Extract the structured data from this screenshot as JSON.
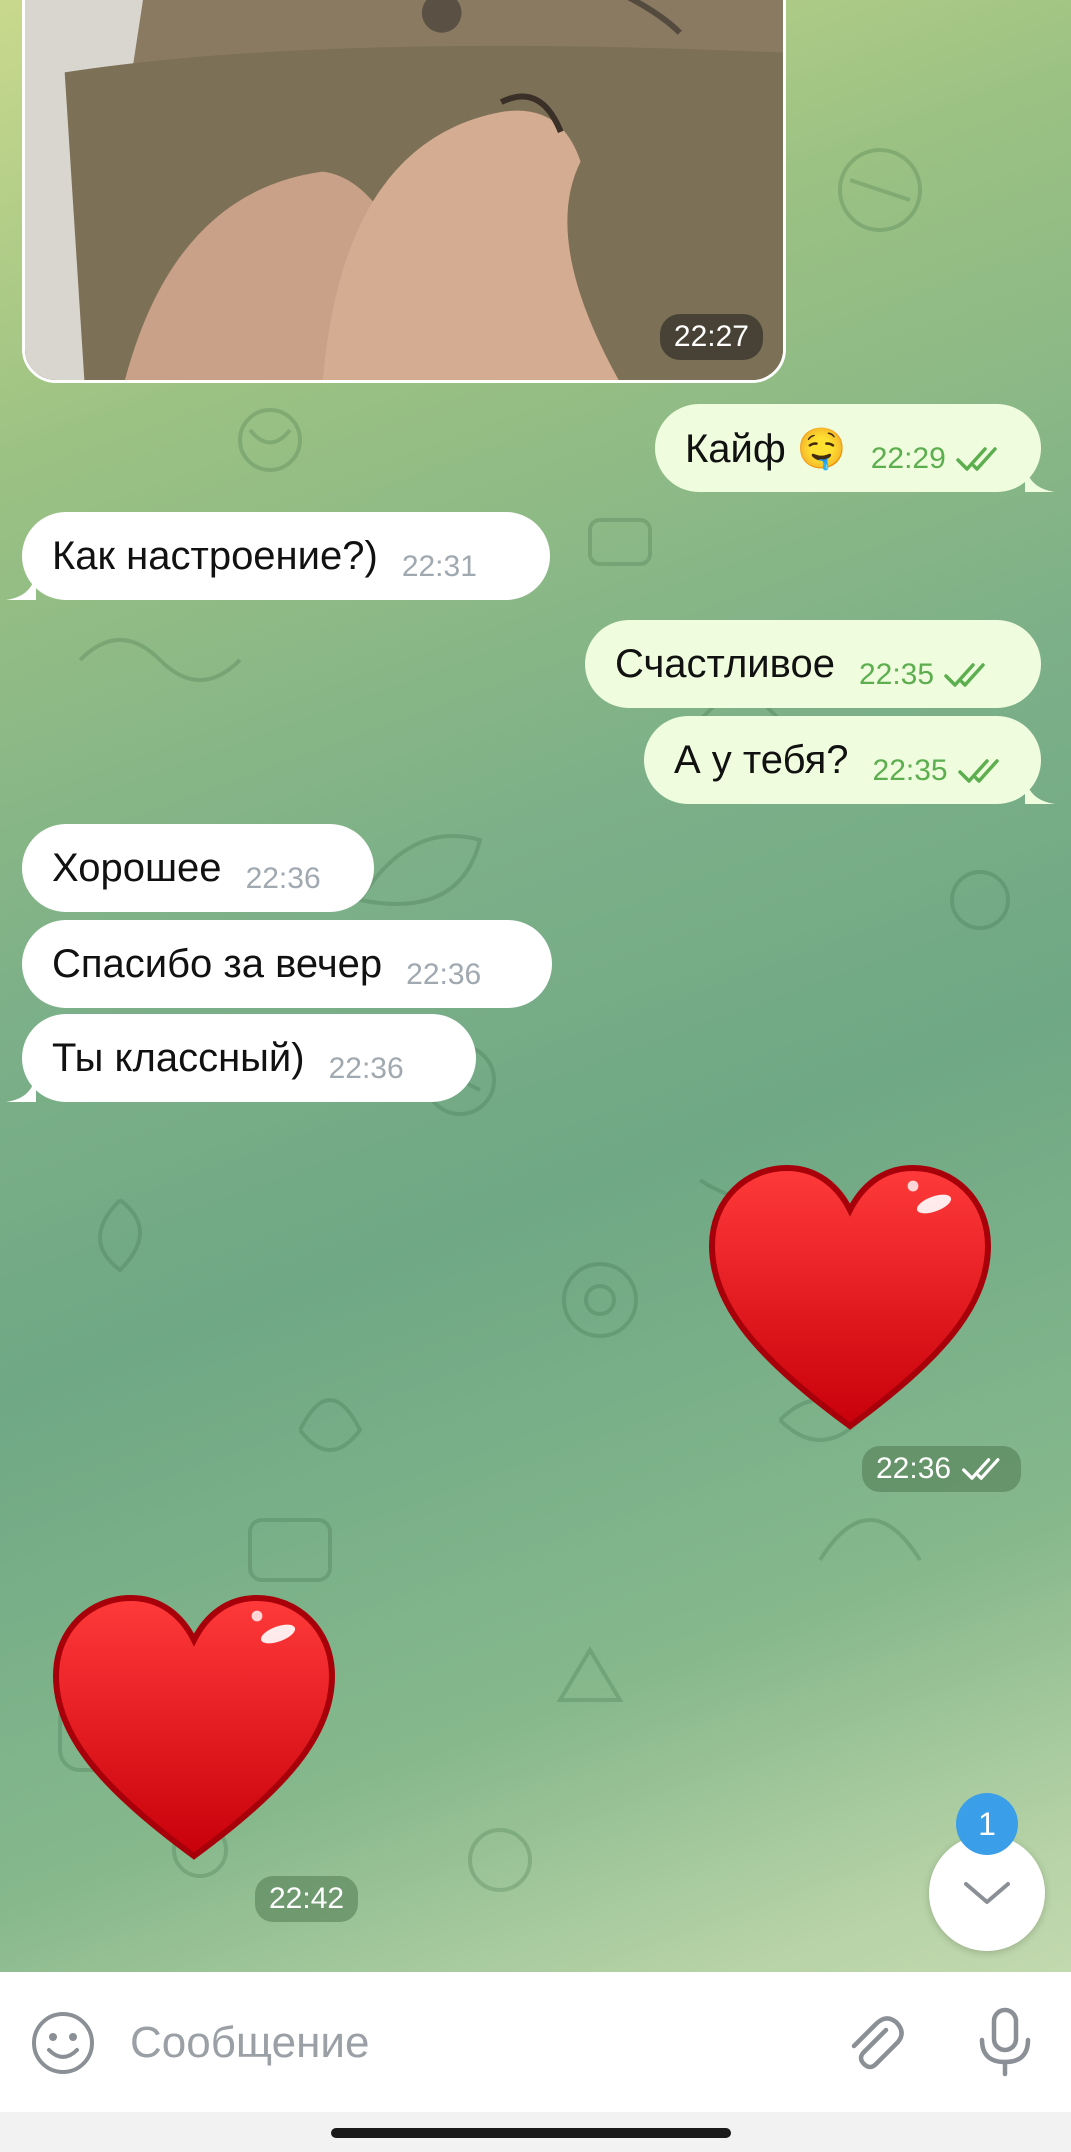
{
  "chat": {
    "photo_message": {
      "time": "22:27"
    },
    "messages": [
      {
        "id": "m1",
        "direction": "out",
        "text": "Кайф 🤤",
        "time": "22:29",
        "read": true
      },
      {
        "id": "m2",
        "direction": "in",
        "text": "Как настроение?)",
        "time": "22:31"
      },
      {
        "id": "m3",
        "direction": "out",
        "text": "Счастливое",
        "time": "22:35",
        "read": true
      },
      {
        "id": "m4",
        "direction": "out",
        "text": "А у тебя?",
        "time": "22:35",
        "read": true
      },
      {
        "id": "m5",
        "direction": "in",
        "text": "Хорошее",
        "time": "22:36"
      },
      {
        "id": "m6",
        "direction": "in",
        "text": "Спасибо за вечер",
        "time": "22:36"
      },
      {
        "id": "m7",
        "direction": "in",
        "text": "Ты классный)",
        "time": "22:36"
      }
    ],
    "stickers": [
      {
        "id": "s1",
        "direction": "out",
        "emoji": "heart",
        "time": "22:36",
        "read": true
      },
      {
        "id": "s2",
        "direction": "in",
        "emoji": "heart",
        "time": "22:42"
      }
    ]
  },
  "scroll_button": {
    "icon": "chevron-down-icon",
    "unread_count": "1"
  },
  "input": {
    "placeholder": "Сообщение",
    "value": ""
  },
  "icons": {
    "emoji": "smiley-icon",
    "attach": "paperclip-icon",
    "mic": "microphone-icon"
  },
  "colors": {
    "outgoing_bubble": "#effdde",
    "incoming_bubble": "#ffffff",
    "outgoing_time": "#5cae4f",
    "badge": "#3a9ee8",
    "heart": "#e8141b"
  }
}
